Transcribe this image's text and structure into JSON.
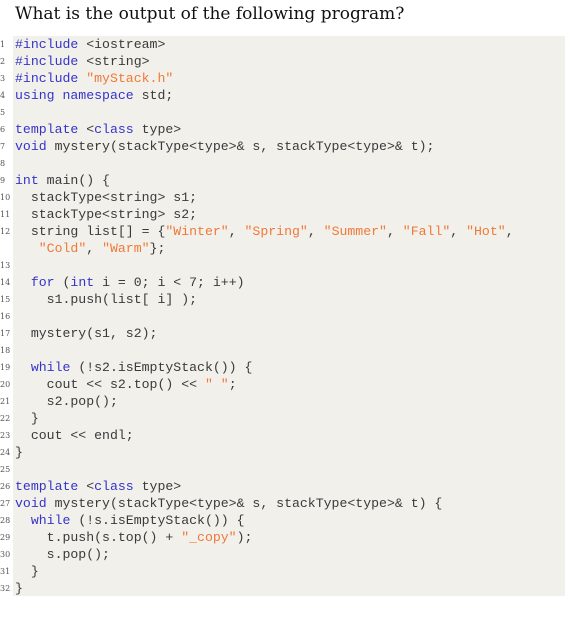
{
  "question": "What is the output of the following program?",
  "colors": {
    "keyword": "#3434c8",
    "string": "#f07838",
    "plain": "#3a3a3a",
    "background": "#f2f0eb"
  },
  "code_lines": [
    {
      "n": "1",
      "tokens": [
        {
          "t": "#include",
          "c": "kw"
        },
        {
          "t": " <iostream>",
          "c": "pl"
        }
      ]
    },
    {
      "n": "2",
      "tokens": [
        {
          "t": "#include",
          "c": "kw"
        },
        {
          "t": " <string>",
          "c": "pl"
        }
      ]
    },
    {
      "n": "3",
      "tokens": [
        {
          "t": "#include",
          "c": "kw"
        },
        {
          "t": " ",
          "c": "pl"
        },
        {
          "t": "\"myStack.h\"",
          "c": "str"
        }
      ]
    },
    {
      "n": "4",
      "tokens": [
        {
          "t": "using namespace",
          "c": "kw"
        },
        {
          "t": " std;",
          "c": "pl"
        }
      ]
    },
    {
      "n": "5",
      "tokens": []
    },
    {
      "n": "6",
      "tokens": [
        {
          "t": "template",
          "c": "kw"
        },
        {
          "t": " <",
          "c": "pl"
        },
        {
          "t": "class",
          "c": "kw"
        },
        {
          "t": " type>",
          "c": "pl"
        }
      ]
    },
    {
      "n": "7",
      "tokens": [
        {
          "t": "void",
          "c": "kw"
        },
        {
          "t": " mystery(stackType<type>& s, stackType<type>& t);",
          "c": "pl"
        }
      ]
    },
    {
      "n": "8",
      "tokens": []
    },
    {
      "n": "9",
      "tokens": [
        {
          "t": "int",
          "c": "kw"
        },
        {
          "t": " main() {",
          "c": "pl"
        }
      ]
    },
    {
      "n": "10",
      "tokens": [
        {
          "t": "  stackType<string> s1;",
          "c": "pl"
        }
      ]
    },
    {
      "n": "11",
      "tokens": [
        {
          "t": "  stackType<string> s2;",
          "c": "pl"
        }
      ]
    },
    {
      "n": "12",
      "tokens": [
        {
          "t": "  string list[] = {",
          "c": "pl"
        },
        {
          "t": "\"Winter\"",
          "c": "str"
        },
        {
          "t": ", ",
          "c": "pl"
        },
        {
          "t": "\"Spring\"",
          "c": "str"
        },
        {
          "t": ", ",
          "c": "pl"
        },
        {
          "t": "\"Summer\"",
          "c": "str"
        },
        {
          "t": ", ",
          "c": "pl"
        },
        {
          "t": "\"Fall\"",
          "c": "str"
        },
        {
          "t": ", ",
          "c": "pl"
        },
        {
          "t": "\"Hot\"",
          "c": "str"
        },
        {
          "t": ",",
          "c": "pl"
        }
      ]
    },
    {
      "n": "",
      "tokens": [
        {
          "t": "   ",
          "c": "pl"
        },
        {
          "t": "\"Cold\"",
          "c": "str"
        },
        {
          "t": ", ",
          "c": "pl"
        },
        {
          "t": "\"Warm\"",
          "c": "str"
        },
        {
          "t": "};",
          "c": "pl"
        }
      ]
    },
    {
      "n": "13",
      "tokens": []
    },
    {
      "n": "14",
      "tokens": [
        {
          "t": "  ",
          "c": "pl"
        },
        {
          "t": "for",
          "c": "kw"
        },
        {
          "t": " (",
          "c": "pl"
        },
        {
          "t": "int",
          "c": "kw"
        },
        {
          "t": " i = 0; i < 7; i++)",
          "c": "pl"
        }
      ]
    },
    {
      "n": "15",
      "tokens": [
        {
          "t": "    s1.push(list[ i] );",
          "c": "pl"
        }
      ]
    },
    {
      "n": "16",
      "tokens": []
    },
    {
      "n": "17",
      "tokens": [
        {
          "t": "  mystery(s1, s2);",
          "c": "pl"
        }
      ]
    },
    {
      "n": "18",
      "tokens": []
    },
    {
      "n": "19",
      "tokens": [
        {
          "t": "  ",
          "c": "pl"
        },
        {
          "t": "while",
          "c": "kw"
        },
        {
          "t": " (!s2.isEmptyStack()) {",
          "c": "pl"
        }
      ]
    },
    {
      "n": "20",
      "tokens": [
        {
          "t": "    cout << s2.top() << ",
          "c": "pl"
        },
        {
          "t": "\" \"",
          "c": "str"
        },
        {
          "t": ";",
          "c": "pl"
        }
      ]
    },
    {
      "n": "21",
      "tokens": [
        {
          "t": "    s2.pop();",
          "c": "pl"
        }
      ]
    },
    {
      "n": "22",
      "tokens": [
        {
          "t": "  }",
          "c": "pl"
        }
      ]
    },
    {
      "n": "23",
      "tokens": [
        {
          "t": "  cout << endl;",
          "c": "pl"
        }
      ]
    },
    {
      "n": "24",
      "tokens": [
        {
          "t": "}",
          "c": "pl"
        }
      ]
    },
    {
      "n": "25",
      "tokens": []
    },
    {
      "n": "26",
      "tokens": [
        {
          "t": "template",
          "c": "kw"
        },
        {
          "t": " <",
          "c": "pl"
        },
        {
          "t": "class",
          "c": "kw"
        },
        {
          "t": " type>",
          "c": "pl"
        }
      ]
    },
    {
      "n": "27",
      "tokens": [
        {
          "t": "void",
          "c": "kw"
        },
        {
          "t": " mystery(stackType<type>& s, stackType<type>& t) {",
          "c": "pl"
        }
      ]
    },
    {
      "n": "28",
      "tokens": [
        {
          "t": "  ",
          "c": "pl"
        },
        {
          "t": "while",
          "c": "kw"
        },
        {
          "t": " (!s.isEmptyStack()) {",
          "c": "pl"
        }
      ]
    },
    {
      "n": "29",
      "tokens": [
        {
          "t": "    t.push(s.top() + ",
          "c": "pl"
        },
        {
          "t": "\"_copy\"",
          "c": "str"
        },
        {
          "t": ");",
          "c": "pl"
        }
      ]
    },
    {
      "n": "30",
      "tokens": [
        {
          "t": "    s.pop();",
          "c": "pl"
        }
      ]
    },
    {
      "n": "31",
      "tokens": [
        {
          "t": "  }",
          "c": "pl"
        }
      ]
    },
    {
      "n": "32",
      "tokens": [
        {
          "t": "}",
          "c": "pl"
        }
      ]
    }
  ]
}
